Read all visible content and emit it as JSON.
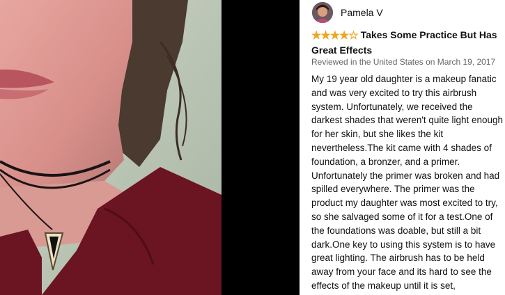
{
  "review": {
    "reviewer_name": "Pamela V",
    "rating": 4,
    "rating_max": 5,
    "title": "Takes Some Practice But Has Great Effects",
    "meta": "Reviewed in the United States on March 19, 2017",
    "body": "My 19 year old daughter is a makeup fanatic and was very excited to try this airbrush system. Unfortunately, we received the darkest shades that weren't quite light enough for her skin, but she likes the kit nevertheless.The kit came with 4 shades of foundation, a bronzer, and a primer. Unfortunately the primer was broken and had spilled everywhere. The primer was the product my daughter was most excited to try, so she salvaged some of it for a test.One of the foundations was doable, but still a bit dark.One key to using this system is to have great lighting. The airbrush has to be held away from your face and its hard to see the effects of the makeup until it is set,"
  },
  "colors": {
    "star": "#f0a51e",
    "photo_background": "#000000",
    "shirt": "#6b1422"
  },
  "icons": {
    "star_filled": "★",
    "star_empty": "☆"
  }
}
